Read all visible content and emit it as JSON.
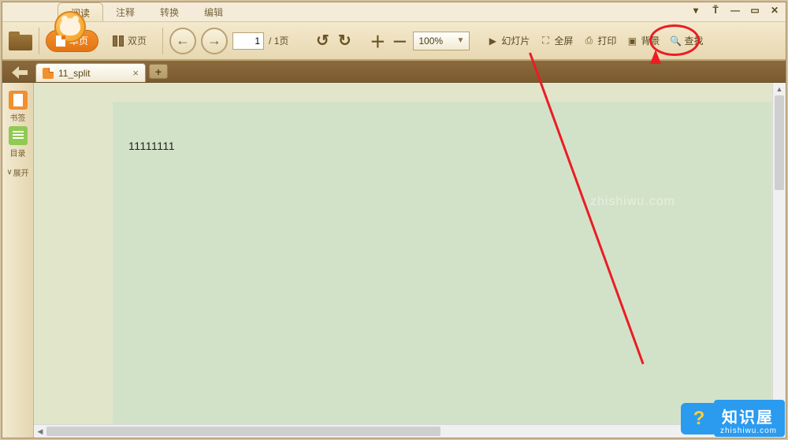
{
  "menu": {
    "tabs": [
      "阅读",
      "注释",
      "转换",
      "编辑"
    ],
    "active_index": 0
  },
  "toolbar": {
    "open_label": "",
    "single_page_label": "单页",
    "double_page_label": "双页",
    "page_current": "1",
    "page_total": "/ 1页",
    "zoom_value": "100%",
    "slideshow_label": "幻灯片",
    "fullscreen_label": "全屏",
    "print_label": "打印",
    "background_label": "背景",
    "find_label": "查找"
  },
  "tabs": {
    "doc_name": "11_split",
    "new_tab": "+"
  },
  "sidebar": {
    "bookmark_label": "书签",
    "toc_label": "目录",
    "expand_label": "展开"
  },
  "document": {
    "body_text": "11111111"
  },
  "watermark": {
    "title": "知识屋",
    "url": "zhishiwu.com",
    "ghost": "zhishiwu.com"
  }
}
